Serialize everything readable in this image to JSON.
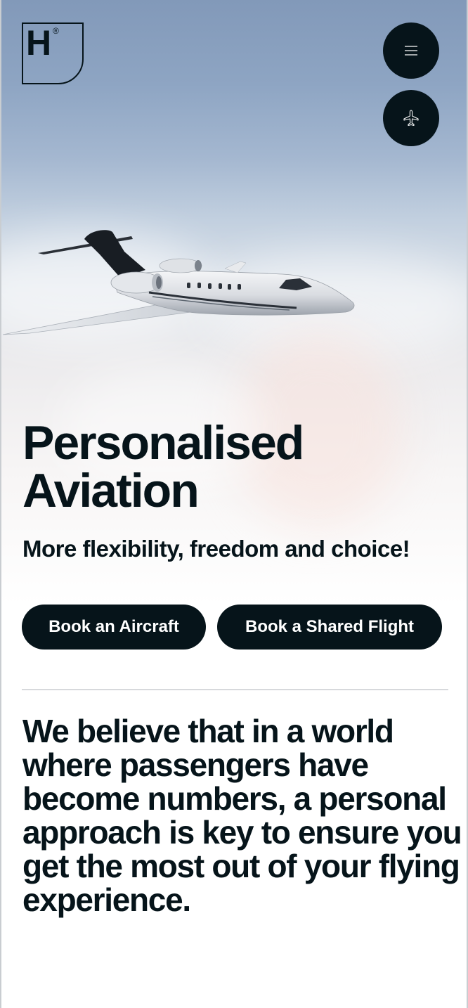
{
  "header": {
    "logo_letter": "H",
    "logo_mark": "®",
    "menu_icon": "hamburger-menu-icon",
    "plane_icon": "airplane-icon"
  },
  "hero": {
    "title_line1": "Personalised",
    "title_line2": "Aviation",
    "subtitle": "More flexibility, freedom and choice!",
    "buttons": {
      "book_aircraft": "Book an Aircraft",
      "book_shared": "Book a Shared Flight"
    }
  },
  "statement": "We believe that in a world where passengers have become numbers, a personal approach is key to ensure you get the most out of your flying experience.",
  "colors": {
    "primary_dark": "#06141a",
    "sky_top": "#8299b9",
    "white": "#ffffff",
    "divider": "#d7d9dc"
  }
}
